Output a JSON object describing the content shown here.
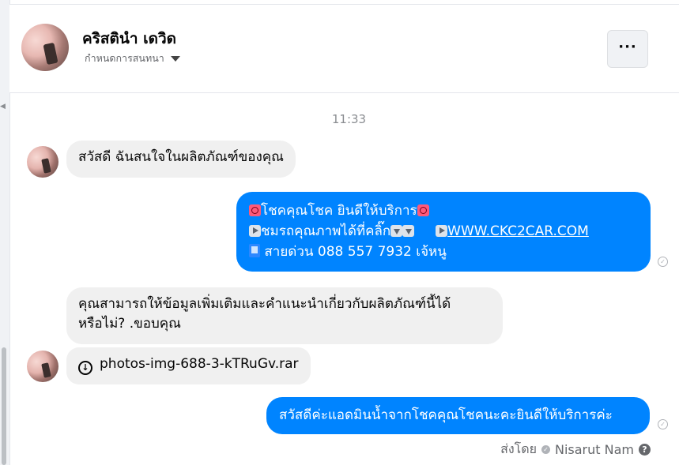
{
  "header": {
    "contact_name": "คริสตินํา เดวิด",
    "subtitle": "กำหนดการสนทนา",
    "more_label": "···"
  },
  "conversation": {
    "timestamp": "11:33",
    "msg1": "สวัสดี ฉันสนใจในผลิตภัณฑ์ของคุณ",
    "promo": {
      "line1": "โชคคุณโชค ยินดีให้บริการ",
      "line2": "ชมรถคุณภาพได้ที่คลิ๊ก",
      "link": "WWW.CKC2CAR.COM",
      "line3": "สายด่วน 088 557 7932 เจ้หนู"
    },
    "msg3_line1": "คุณสามารถให้ข้อมูลเพิ่มเติมและคำแนะนำเกี่ยวกับผลิตภัณฑ์นี้ได้",
    "msg3_line2": "หรือไม่? .ขอบคุณ",
    "file_name": "photos-img-688-3-kTRuGv.rar",
    "reply": "สวัสดีค่ะแอดมินน้ำจากโชคคุณโชคนะคะยินดีให้บริการค่ะ",
    "sent_by_label": "ส่งโดย",
    "sent_by_name": "Nisarut Nam"
  },
  "colors": {
    "outgoing_bubble": "#0084ff",
    "incoming_bubble": "#f0f0f0",
    "meta_text": "#65676b"
  }
}
